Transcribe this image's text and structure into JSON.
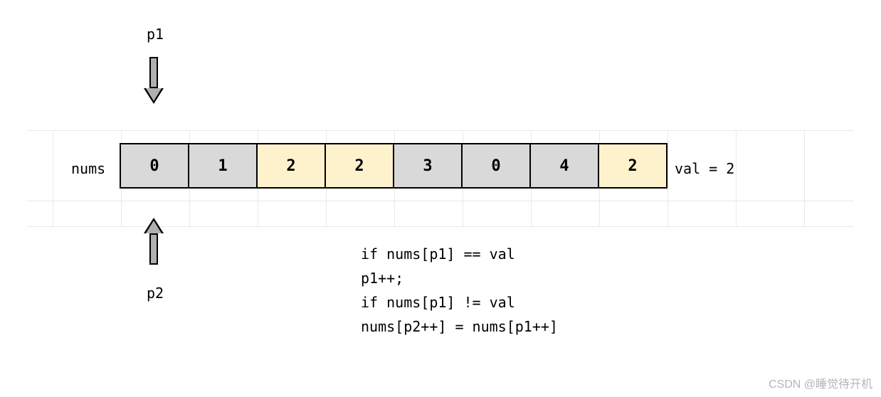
{
  "pointers": {
    "p1": {
      "label": "p1",
      "index": 0
    },
    "p2": {
      "label": "p2",
      "index": 0
    }
  },
  "array_label": "nums",
  "val_label": "val = 2",
  "cells": [
    {
      "value": "0",
      "highlight": false
    },
    {
      "value": "1",
      "highlight": false
    },
    {
      "value": "2",
      "highlight": true
    },
    {
      "value": "2",
      "highlight": true
    },
    {
      "value": "3",
      "highlight": false
    },
    {
      "value": "0",
      "highlight": false
    },
    {
      "value": "4",
      "highlight": false
    },
    {
      "value": "2",
      "highlight": true
    }
  ],
  "code": {
    "line1": "if nums[p1] == val",
    "line2": "p1++;",
    "line3": "if nums[p1] != val",
    "line4": "nums[p2++] = nums[p1++]"
  },
  "watermark": "CSDN @睡觉待开机",
  "chart_data": {
    "type": "table",
    "title": "Array state for remove-element two-pointer illustration",
    "array_name": "nums",
    "array": [
      0,
      1,
      2,
      2,
      3,
      0,
      4,
      2
    ],
    "target_value": 2,
    "highlight_indices": [
      2,
      3,
      7
    ],
    "pointers": {
      "p1": 0,
      "p2": 0
    },
    "pseudocode": [
      "if nums[p1] == val",
      "p1++;",
      "if nums[p1] != val",
      "nums[p2++] = nums[p1++]"
    ]
  }
}
